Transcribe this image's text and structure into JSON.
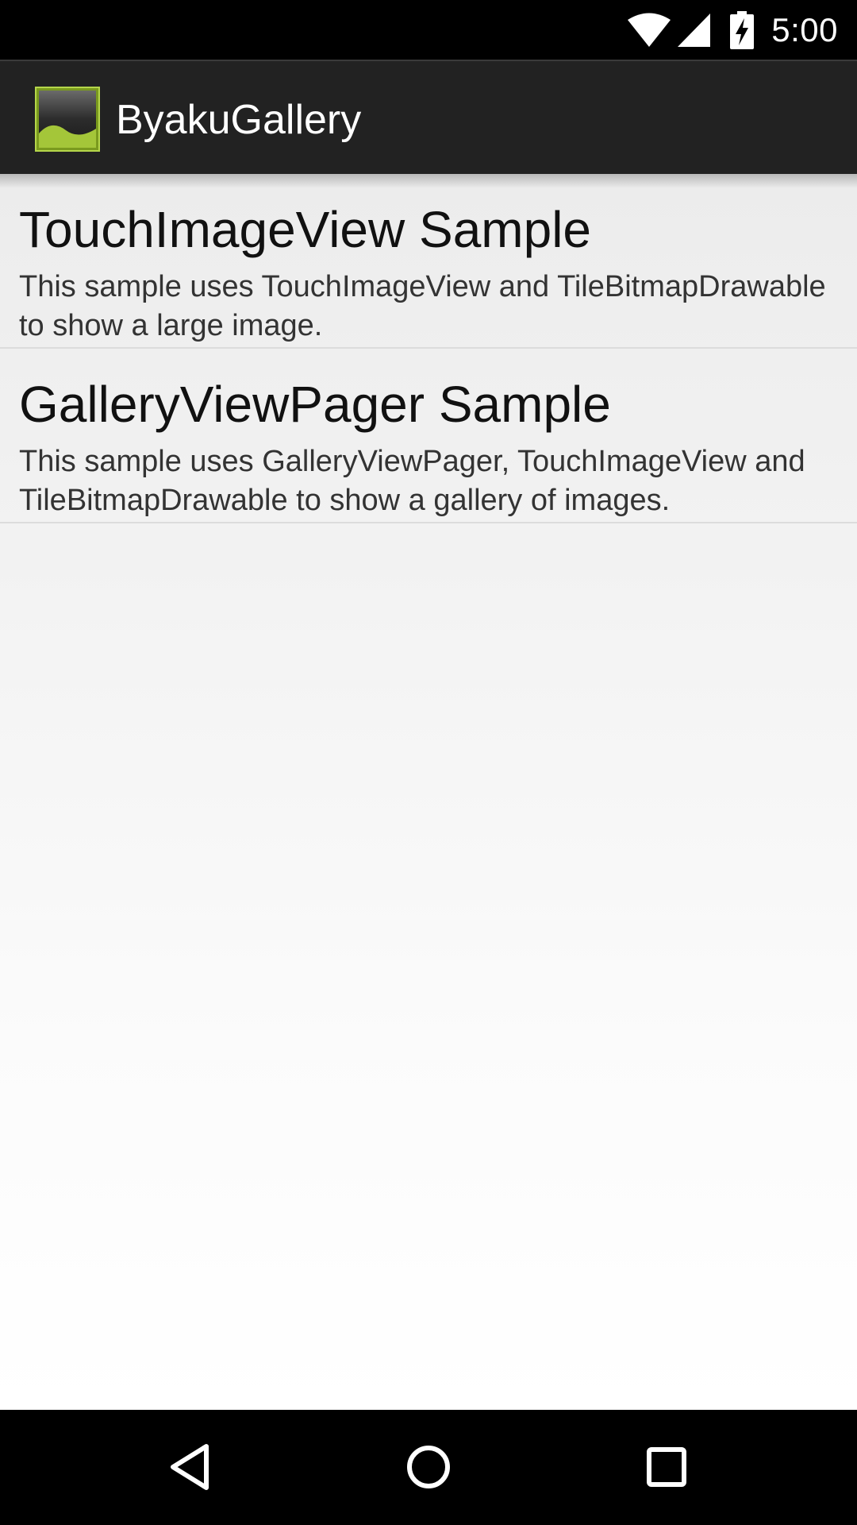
{
  "status_bar": {
    "time": "5:00",
    "icons": [
      "wifi-icon",
      "signal-icon",
      "battery-charging-icon"
    ]
  },
  "action_bar": {
    "app_icon": "gallery-image-icon",
    "title": "ByakuGallery"
  },
  "list": {
    "items": [
      {
        "title": "TouchImageView Sample",
        "description": "This sample uses TouchImageView and TileBitmapDrawable to show a large image."
      },
      {
        "title": "GalleryViewPager Sample",
        "description": "This sample uses GalleryViewPager, TouchImageView and TileBitmapDrawable to show a gallery of images."
      }
    ]
  },
  "nav_bar": {
    "icons": [
      "back-icon",
      "home-icon",
      "recents-icon"
    ]
  },
  "colors": {
    "action_bar": "#222222",
    "app_icon_accent": "#a4c639",
    "background": "#f1f1f1"
  }
}
